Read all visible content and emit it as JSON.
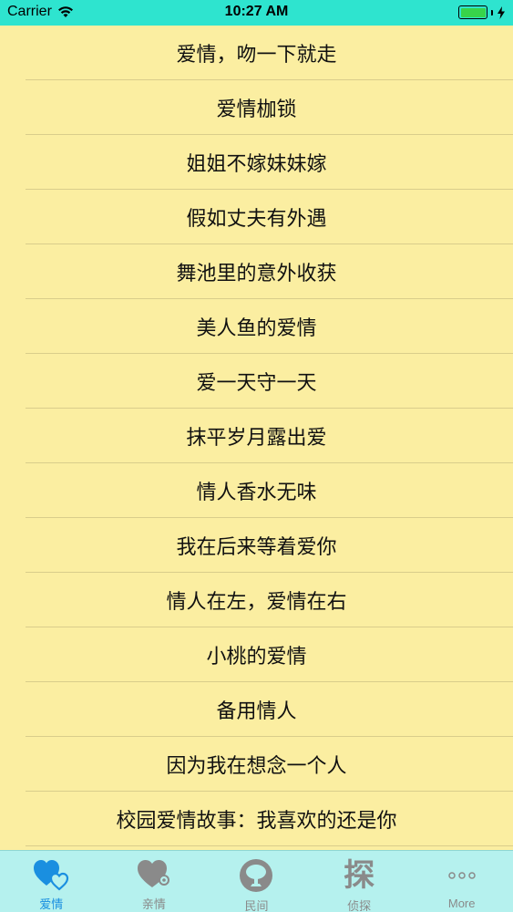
{
  "status_bar": {
    "carrier": "Carrier",
    "time": "10:27 AM"
  },
  "stories": [
    "爱情，吻一下就走",
    "爱情枷锁",
    "姐姐不嫁妹妹嫁",
    "假如丈夫有外遇",
    "舞池里的意外收获",
    "美人鱼的爱情",
    "爱一天守一天",
    "抹平岁月露出爱",
    "情人香水无味",
    "我在后来等着爱你",
    "情人在左，爱情在右",
    "小桃的爱情",
    "备用情人",
    "因为我在想念一个人",
    "校园爱情故事：我喜欢的还是你"
  ],
  "tabs": [
    {
      "label": "爱情",
      "icon": "hearts-icon",
      "active": true
    },
    {
      "label": "亲情",
      "icon": "heart-icon",
      "active": false
    },
    {
      "label": "民间",
      "icon": "tree-icon",
      "active": false
    },
    {
      "label": "侦探",
      "icon": "tan-character-icon",
      "active": false,
      "glyph": "探"
    },
    {
      "label": "More",
      "icon": "more-icon",
      "active": false
    }
  ],
  "colors": {
    "status_bar": "#2ee4cf",
    "background": "#fbeea1",
    "tab_bar": "#b5f1ee",
    "accent": "#1a8fe0",
    "inactive": "#8a8a8a"
  }
}
